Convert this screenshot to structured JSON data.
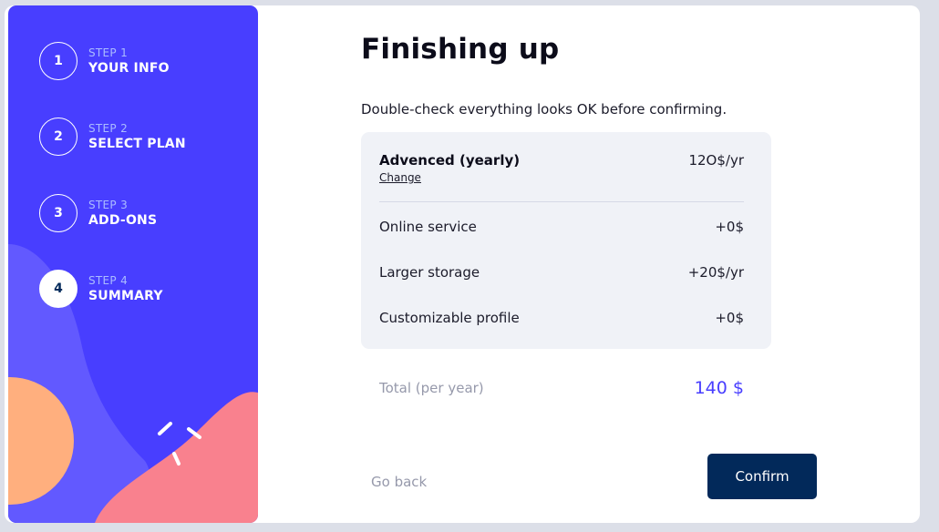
{
  "colors": {
    "sidebar_bg": "#483eff",
    "confirm_bg": "#02295a",
    "total_accent": "#483eff",
    "summary_bg": "#f0f2f7",
    "decor_orange": "#ffaf7e",
    "decor_pink": "#f9818e",
    "decor_purple": "#6259ff"
  },
  "sidebar": {
    "steps": [
      {
        "number": "1",
        "step_label": "STEP 1",
        "title": "YOUR INFO",
        "active": false
      },
      {
        "number": "2",
        "step_label": "STEP 2",
        "title": "SELECT PLAN",
        "active": false
      },
      {
        "number": "3",
        "step_label": "STEP 3",
        "title": "ADD-ONS",
        "active": false
      },
      {
        "number": "4",
        "step_label": "STEP 4",
        "title": "SUMMARY",
        "active": true
      }
    ]
  },
  "main": {
    "title": "Finishing up",
    "subtitle": "Double-check everything looks OK before confirming.",
    "plan": {
      "name": "Advenced (yearly)",
      "change_label": "Change",
      "price": "12O$/yr"
    },
    "addons": [
      {
        "name": "Online service",
        "price": "+0$"
      },
      {
        "name": "Larger storage",
        "price": "+20$/yr"
      },
      {
        "name": "Customizable profile",
        "price": "+0$"
      }
    ],
    "total": {
      "label": "Total (per year)",
      "value": "140 $"
    }
  },
  "footer": {
    "back_label": "Go back",
    "confirm_label": "Confirm"
  }
}
